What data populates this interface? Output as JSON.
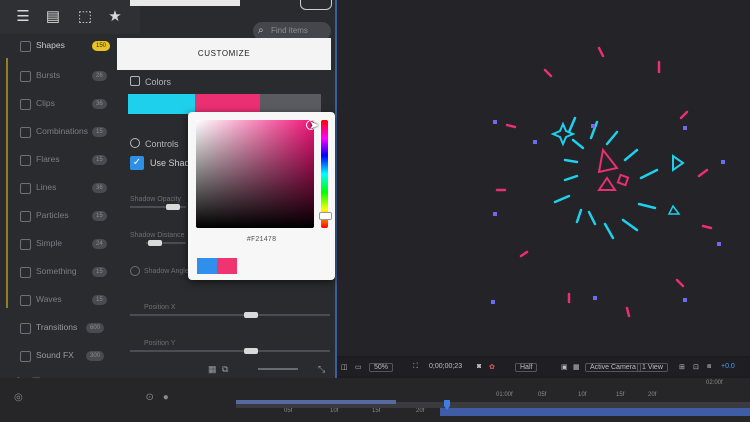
{
  "toolbar": {
    "icons": [
      "sliders-icon",
      "list-icon",
      "export-icon",
      "star-icon"
    ]
  },
  "search": {
    "placeholder": "Find items",
    "icon": "search-icon"
  },
  "sidebar": {
    "items": [
      {
        "label": "Shapes",
        "badge": "150",
        "active": true
      },
      {
        "label": "Bursts",
        "badge": "26"
      },
      {
        "label": "Clips",
        "badge": "36"
      },
      {
        "label": "Combinations",
        "badge": "15"
      },
      {
        "label": "Flares",
        "badge": "15"
      },
      {
        "label": "Lines",
        "badge": "36"
      },
      {
        "label": "Particles",
        "badge": "15"
      },
      {
        "label": "Simple",
        "badge": "24"
      },
      {
        "label": "Something",
        "badge": "15"
      },
      {
        "label": "Waves",
        "badge": "15"
      },
      {
        "label": "Transitions",
        "badge": "600"
      },
      {
        "label": "Sound FX",
        "badge": "300"
      }
    ]
  },
  "customize": {
    "title": "CUSTOMIZE",
    "colors_label": "Colors",
    "swatches": [
      "#1fd0ec",
      "#ea2f72",
      "#5a5b60"
    ],
    "controls_label": "Controls",
    "shadow_label": "Use Shadow",
    "params": [
      "Shadow Opacity",
      "Shadow Distance",
      "Shadow Angle",
      "Position X",
      "Position Y"
    ]
  },
  "picker": {
    "hex": "#F21478",
    "selected_color": "#f21478",
    "preview_colors": [
      "#2f8fea",
      "#f0346f"
    ]
  },
  "viewer_toolbar": {
    "zoom": "50%",
    "timecode": "0;00;00;23",
    "resolution": "Half",
    "camera": "Active Camera",
    "views": "1 View",
    "offset": "+0.0"
  },
  "timeline": {
    "ticks": [
      "05f",
      "10f",
      "15f",
      "20f",
      "25f",
      "01:00f",
      "05f",
      "10f",
      "15f",
      "20f"
    ],
    "end_label": "02:00f"
  },
  "colors": {
    "accent_cyan": "#1fd0ec",
    "accent_pink": "#ea2f72",
    "accent_blue": "#2e8fe6",
    "badge_yellow": "#e9c225"
  }
}
